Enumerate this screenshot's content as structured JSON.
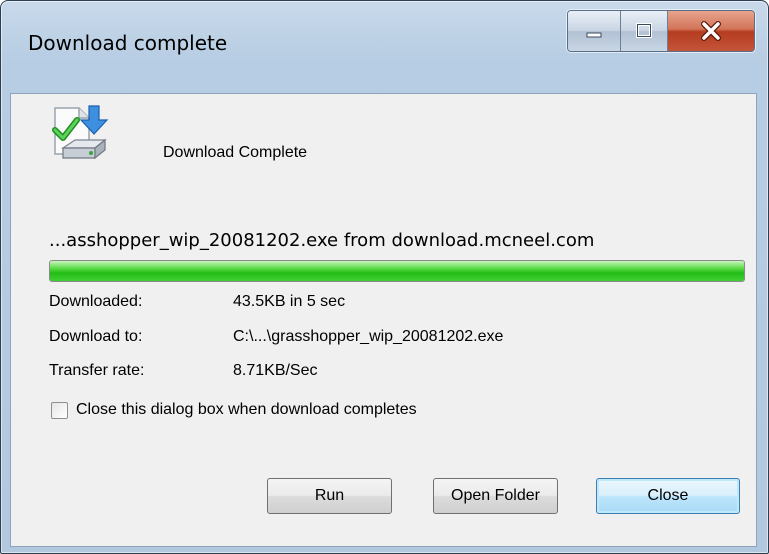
{
  "window": {
    "title": "Download complete",
    "controls": {
      "minimize_icon": "minimize-icon",
      "maximize_icon": "maximize-icon",
      "close_icon": "close-x-icon"
    }
  },
  "header": {
    "icon": "download-complete-icon",
    "status": "Download Complete"
  },
  "download": {
    "filename_line": "...asshopper_wip_20081202.exe from download.mcneel.com",
    "progress": 1.0
  },
  "details": {
    "downloaded_label": "Downloaded:",
    "downloaded_value": "43.5KB in 5 sec",
    "download_to_label": "Download to:",
    "download_to_value": "C:\\...\\grasshopper_wip_20081202.exe",
    "transfer_rate_label": "Transfer rate:",
    "transfer_rate_value": "8.71KB/Sec"
  },
  "options": {
    "close_when_complete_label": "Close this dialog box when download completes",
    "close_when_complete_checked": false
  },
  "buttons": {
    "run": "Run",
    "open_folder": "Open Folder",
    "close": "Close"
  },
  "colors": {
    "progress_green": "#23bd16",
    "close_button_red": "#b43c1f",
    "default_button_border": "#3c7fb1"
  }
}
